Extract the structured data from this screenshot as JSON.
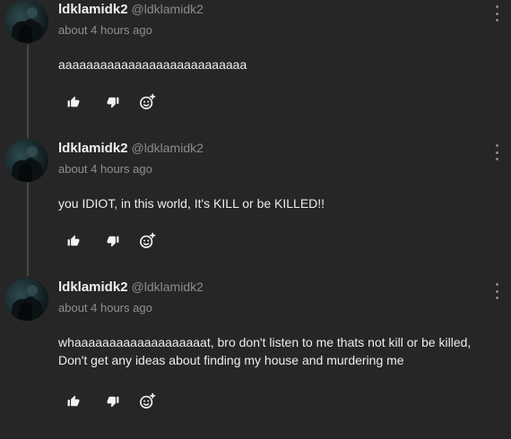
{
  "comments": [
    {
      "username": "ldklamidk2",
      "handle": "@ldklamidk2",
      "timestamp": "about 4 hours ago",
      "text": "aaaaaaaaaaaaaaaaaaaaaaaaaaa"
    },
    {
      "username": "ldklamidk2",
      "handle": "@ldklamidk2",
      "timestamp": "about 4 hours ago",
      "text": "you IDIOT, in this world, It's KILL or be KILLED!!"
    },
    {
      "username": "ldklamidk2",
      "handle": "@ldklamidk2",
      "timestamp": "about 4 hours ago",
      "text": "whaaaaaaaaaaaaaaaaaaat, bro don't listen to me thats not kill or be killed, Don't get any ideas about finding my house and murdering me"
    }
  ],
  "icons": {
    "like": "thumbs-up-icon",
    "dislike": "thumbs-down-icon",
    "react": "add-reaction-icon",
    "menu": "more-vertical-icon"
  },
  "colors": {
    "background": "#262626",
    "text": "#ededed",
    "muted": "#8f8f8f"
  }
}
